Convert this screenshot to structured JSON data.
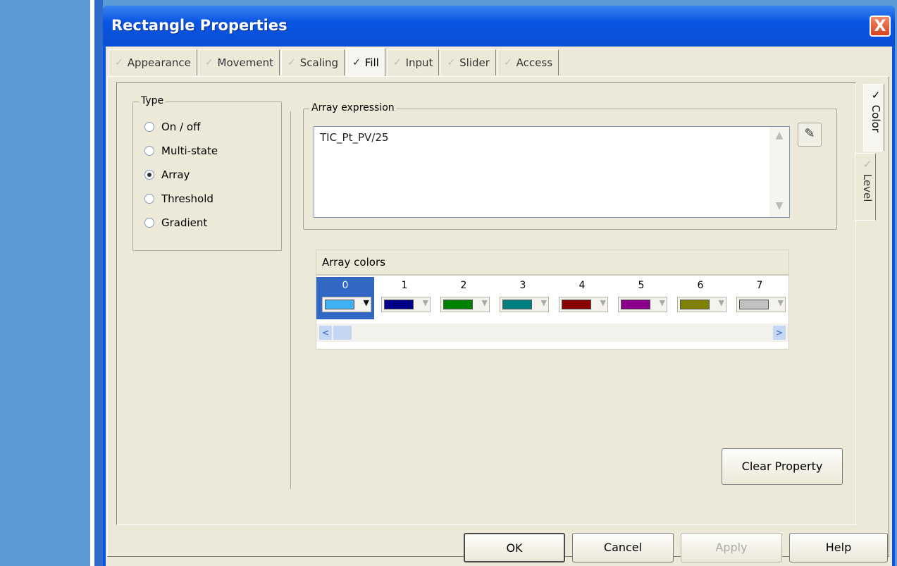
{
  "window": {
    "title": "Rectangle Properties",
    "close_glyph": "X"
  },
  "tabs": [
    {
      "label": "Appearance",
      "check": "✓",
      "active": false
    },
    {
      "label": "Movement",
      "check": "✓",
      "active": false
    },
    {
      "label": "Scaling",
      "check": "✓",
      "active": false
    },
    {
      "label": "Fill",
      "check": "✓",
      "active": true
    },
    {
      "label": "Input",
      "check": "✓",
      "active": false
    },
    {
      "label": "Slider",
      "check": "✓",
      "active": false
    },
    {
      "label": "Access",
      "check": "✓",
      "active": false
    }
  ],
  "side_tabs": [
    {
      "label": "Color",
      "check": "✓",
      "active": true
    },
    {
      "label": "Level",
      "check": "✓",
      "active": false
    }
  ],
  "type_group": {
    "legend": "Type",
    "options": [
      {
        "label": "On / off",
        "checked": false
      },
      {
        "label": "Multi-state",
        "checked": false
      },
      {
        "label": "Array",
        "checked": true
      },
      {
        "label": "Threshold",
        "checked": false
      },
      {
        "label": "Gradient",
        "checked": false
      }
    ]
  },
  "array_expression": {
    "legend": "Array expression",
    "value": "TIC_Pt_PV/25",
    "tag_button_icon": "tag-browse-icon"
  },
  "array_colors": {
    "header": "Array colors",
    "selected_index": 0,
    "cells": [
      {
        "index": "0",
        "color": "#3fb0f0"
      },
      {
        "index": "1",
        "color": "#00008b"
      },
      {
        "index": "2",
        "color": "#008000"
      },
      {
        "index": "3",
        "color": "#008080"
      },
      {
        "index": "4",
        "color": "#8b0000"
      },
      {
        "index": "5",
        "color": "#8b008b"
      },
      {
        "index": "6",
        "color": "#808000"
      },
      {
        "index": "7",
        "color": "#c0c0c0"
      }
    ],
    "scroll_left": "<",
    "scroll_right": ">"
  },
  "buttons": {
    "clear_property": "Clear Property",
    "ok": "OK",
    "cancel": "Cancel",
    "apply": "Apply",
    "help": "Help"
  }
}
